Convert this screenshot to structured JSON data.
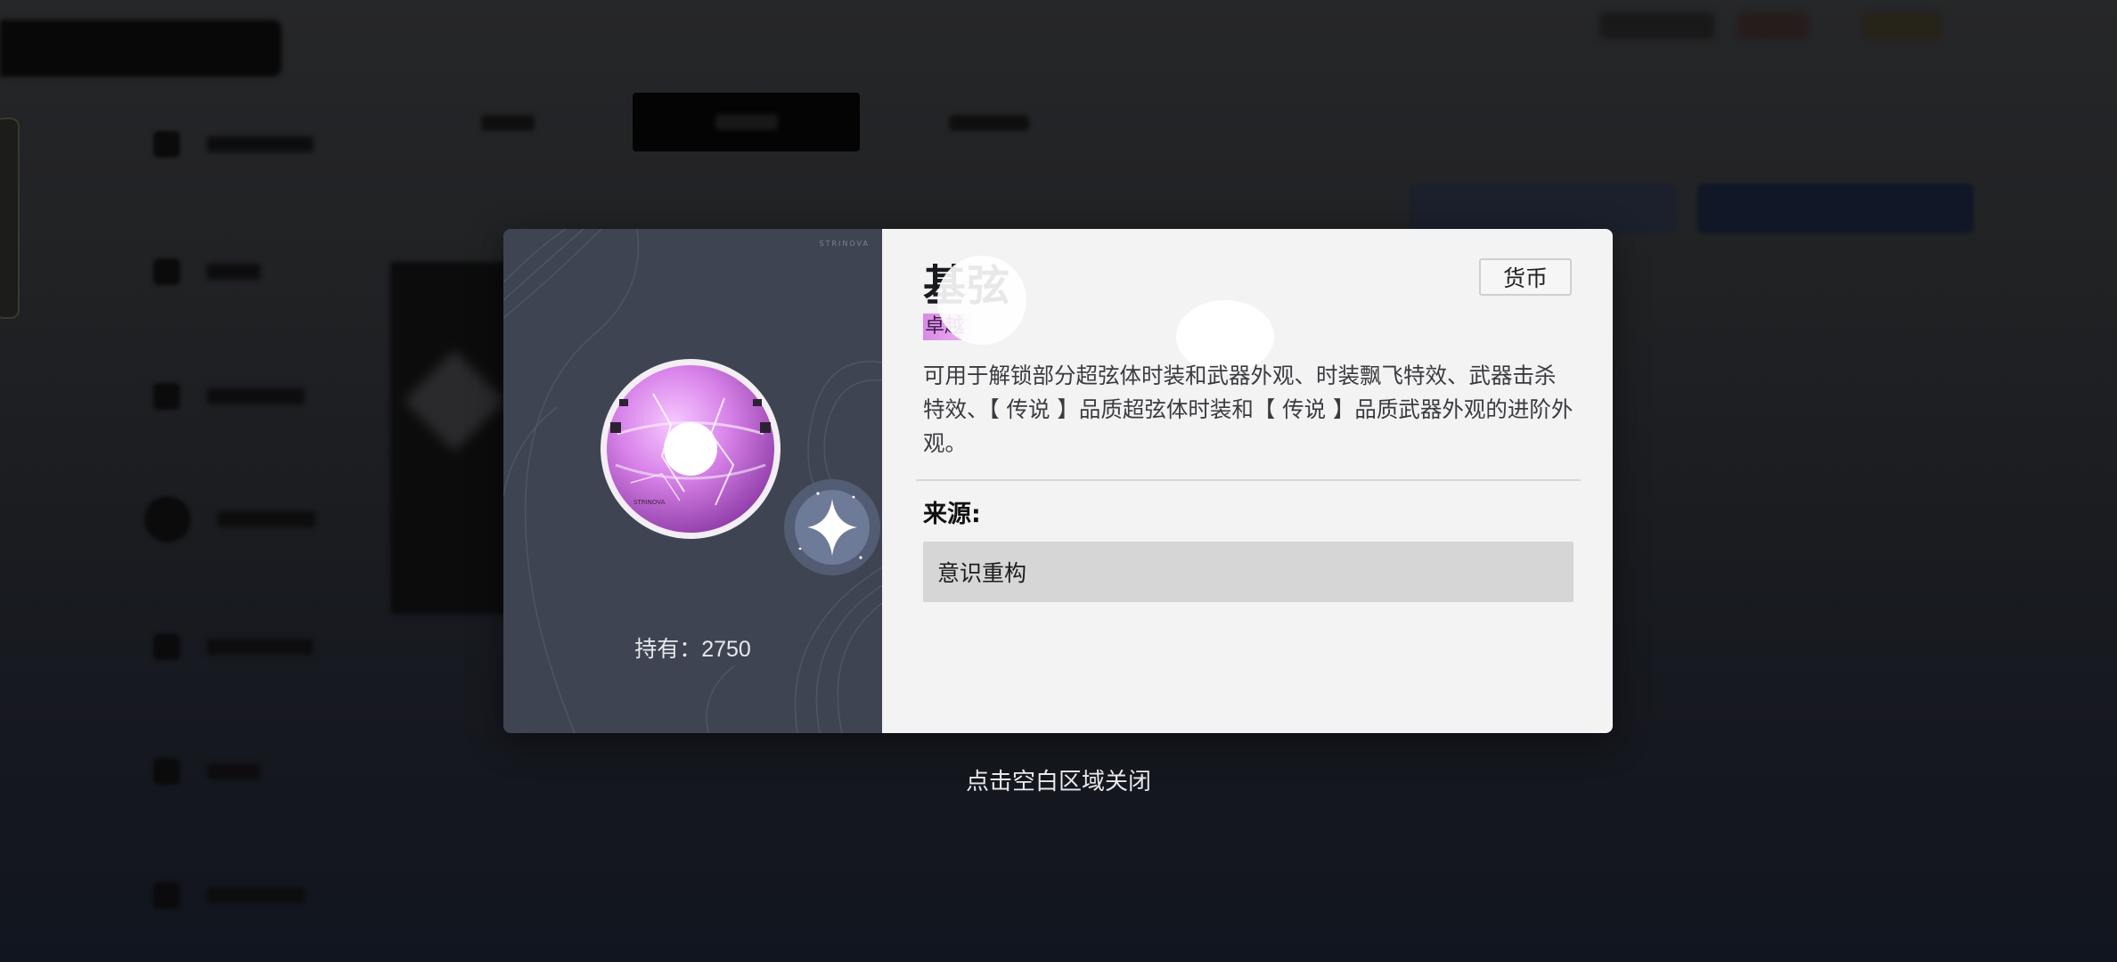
{
  "item": {
    "name": "基弦",
    "type_tag": "货币",
    "rarity": "卓越",
    "description": "可用于解锁部分超弦体时装和武器外观、时装飘飞特效、武器击杀特效、【 传说 】品质超弦体时装和【 传说 】品质武器外观的进阶外观。",
    "hold_text": "持有：2750",
    "brand_mark": "STRINOVA",
    "orb_icon": "pink-crystal-orb-icon",
    "sparkle_icon": "sparkle-star-icon"
  },
  "source": {
    "label": "来源:",
    "entries": [
      "意识重构"
    ]
  },
  "hint": {
    "close": "点击空白区域关闭"
  },
  "colors": {
    "rarity_accent": "#d98ae6",
    "left_panel": "#3e4452",
    "right_panel": "#f3f3f3",
    "source_row": "#d6d6d6"
  }
}
